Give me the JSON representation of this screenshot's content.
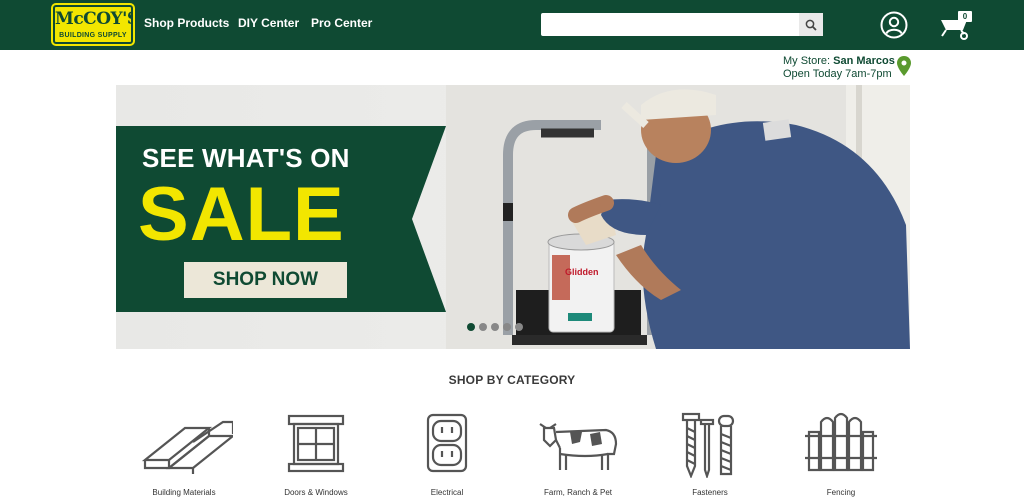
{
  "brand": {
    "name": "McCOY'S",
    "tagline": "BUILDING SUPPLY"
  },
  "nav": {
    "items": [
      "Shop Products",
      "DIY Center",
      "Pro Center"
    ]
  },
  "search": {
    "placeholder": "",
    "value": ""
  },
  "cart": {
    "count": "0"
  },
  "store": {
    "prefix": "My Store:",
    "name": "San Marcos",
    "hours": "Open Today 7am-7pm"
  },
  "banner": {
    "headline": "SEE WHAT'S ON",
    "big": "SALE",
    "cta": "SHOP NOW",
    "can_brand": "Glidden",
    "slides": 5,
    "active_slide": 1
  },
  "categories": {
    "title": "SHOP BY CATEGORY",
    "items": [
      {
        "label": "Building Materials",
        "icon": "lumber-icon"
      },
      {
        "label": "Doors & Windows",
        "icon": "window-icon"
      },
      {
        "label": "Electrical",
        "icon": "outlet-icon"
      },
      {
        "label": "Farm, Ranch & Pet",
        "icon": "cow-icon"
      },
      {
        "label": "Fasteners",
        "icon": "screws-icon"
      },
      {
        "label": "Fencing",
        "icon": "fence-icon"
      }
    ]
  },
  "colors": {
    "brand_green": "#0f4a33",
    "brand_yellow": "#f2e600",
    "pin_green": "#5a9a2e"
  }
}
